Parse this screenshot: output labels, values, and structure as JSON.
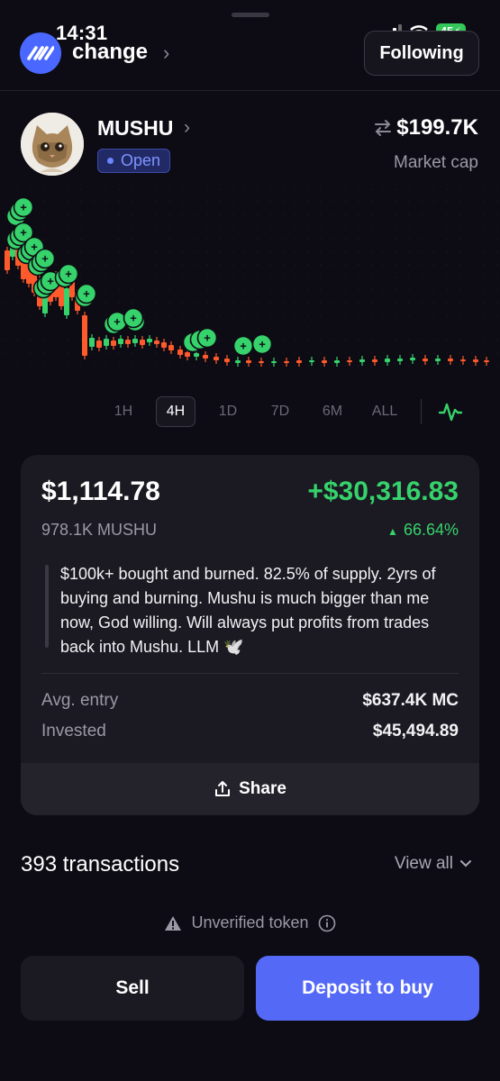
{
  "status_bar": {
    "time": "14:31",
    "battery": "45"
  },
  "header": {
    "app_name": "change",
    "following_label": "Following"
  },
  "token": {
    "name": "MUSHU",
    "status_badge": "Open",
    "market_cap_value": "$199.7K",
    "market_cap_label": "Market cap"
  },
  "chart": {
    "type": "candlestick",
    "buy_marker_glyph": "+",
    "up_color": "#36d26b",
    "down_color": "#ff5a2c"
  },
  "ranges": [
    "1H",
    "4H",
    "1D",
    "7D",
    "6M",
    "ALL"
  ],
  "selected_range": "4H",
  "position": {
    "value": "$1,114.78",
    "pnl": "+$30,316.83",
    "amount": "978.1K MUSHU",
    "percent": "66.64%",
    "note": "$100k+ bought and burned. 82.5% of supply. 2yrs of buying and burning. Mushu is much bigger than me now, God willing. Will always put profits from trades back into Mushu. LLM 🕊️",
    "avg_entry_label": "Avg. entry",
    "avg_entry_value": "$637.4K MC",
    "invested_label": "Invested",
    "invested_value": "$45,494.89",
    "share_label": "Share"
  },
  "transactions": {
    "count_label": "393 transactions",
    "view_all_label": "View all"
  },
  "warning": {
    "label": "Unverified token"
  },
  "actions": {
    "sell_label": "Sell",
    "deposit_label": "Deposit to buy"
  },
  "colors": {
    "accent": "#5569f7",
    "positive": "#36d26b",
    "negative": "#ff5a2c",
    "background": "#0d0c14"
  }
}
